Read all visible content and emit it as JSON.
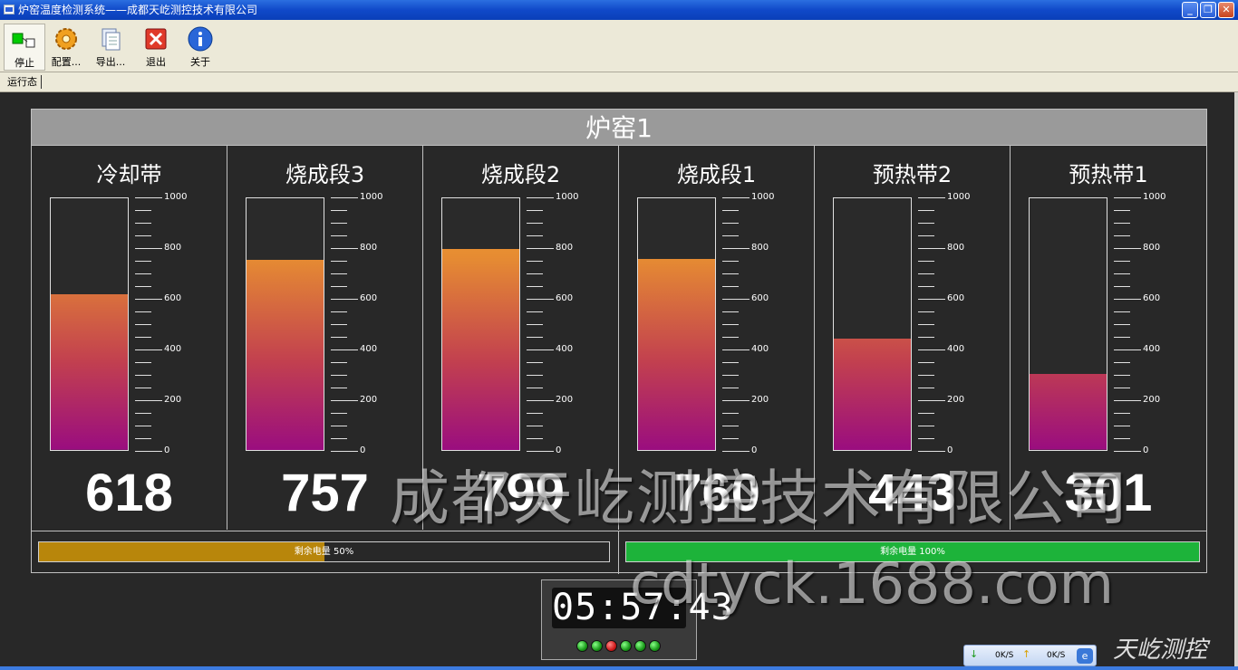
{
  "window": {
    "title": "炉窑温度检测系统——成都天屹测控技术有限公司"
  },
  "toolbar": {
    "items": [
      {
        "label": "停止",
        "icon": "stop-icon"
      },
      {
        "label": "配置...",
        "icon": "gear-icon"
      },
      {
        "label": "导出...",
        "icon": "export-icon"
      },
      {
        "label": "退出",
        "icon": "exit-icon"
      },
      {
        "label": "关于",
        "icon": "info-icon"
      }
    ]
  },
  "status_tab": "运行态",
  "panel": {
    "title": "炉窑1",
    "scale": {
      "max": 1000,
      "min": 0,
      "labels": [
        "1000",
        "800",
        "600",
        "400",
        "200",
        "0"
      ]
    },
    "zones": [
      {
        "name": "冷却带",
        "value": "618",
        "level": 618
      },
      {
        "name": "烧成段3",
        "value": "757",
        "level": 757
      },
      {
        "name": "烧成段2",
        "value": "799",
        "level": 799
      },
      {
        "name": "烧成段1",
        "value": "760",
        "level": 760
      },
      {
        "name": "预热带2",
        "value": "443",
        "level": 443
      },
      {
        "name": "预热带1",
        "value": "301",
        "level": 301
      }
    ],
    "batteries": [
      {
        "label": "剩余电量 50%",
        "level": 0.5,
        "color": "#b8860b"
      },
      {
        "label": "剩余电量 100%",
        "level": 1.0,
        "color": "#1db33a"
      }
    ]
  },
  "clock": {
    "time": "05:57:43",
    "leds": [
      "green",
      "green",
      "red",
      "green",
      "green",
      "green"
    ]
  },
  "watermark": {
    "company": "成都天屹测控技术有限公司",
    "url": "cdtyck.1688.com",
    "brand": "天屹测控"
  },
  "tray": {
    "down": "0K/S",
    "up": "0K/S"
  }
}
